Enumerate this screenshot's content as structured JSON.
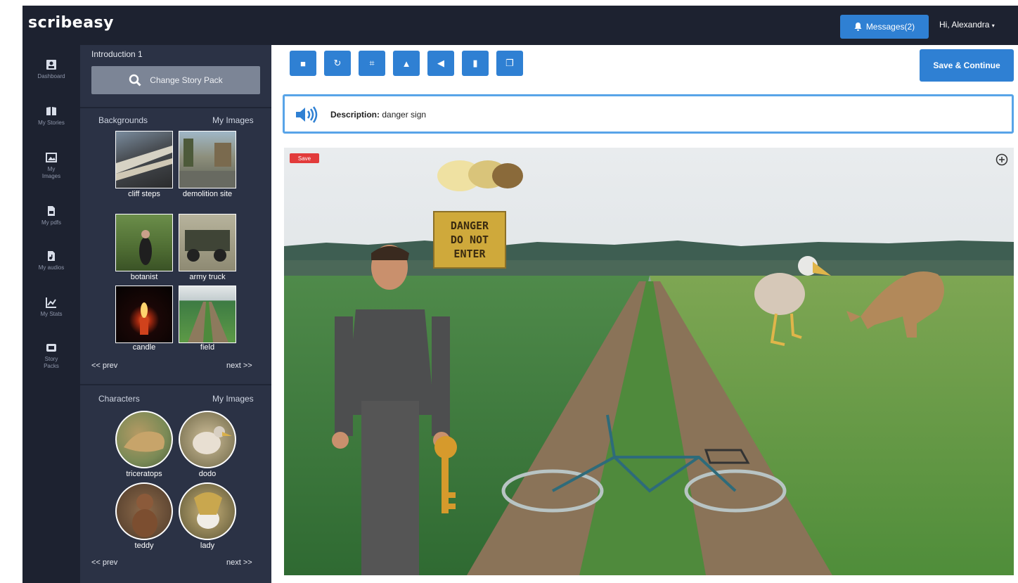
{
  "app": {
    "logo": "scribeasy",
    "messages_label": "Messages(2)",
    "user_label": "Hi, Alexandra"
  },
  "rail": {
    "items": [
      {
        "label": "Dashboard",
        "icon": "dashboard-icon"
      },
      {
        "label": "My Stories",
        "icon": "book-icon"
      },
      {
        "label": "My Images",
        "icon": "image-icon"
      },
      {
        "label": "My pdfs",
        "icon": "pdf-icon"
      },
      {
        "label": "My audios",
        "icon": "audio-icon"
      },
      {
        "label": "My Stats",
        "icon": "stats-icon"
      },
      {
        "label": "Story Packs",
        "icon": "pack-icon"
      }
    ]
  },
  "panel": {
    "title": "Introduction 1",
    "change_pack_label": "Change Story Pack",
    "backgrounds": {
      "label": "Backgrounds",
      "my_images": "My Images",
      "items": [
        "cliff steps",
        "demolition site",
        "botanist",
        "army truck",
        "candle",
        "field"
      ],
      "prev": "<< prev",
      "next": "next >>"
    },
    "characters": {
      "label": "Characters",
      "my_images": "My Images",
      "items": [
        "triceratops",
        "dodo",
        "teddy",
        "lady"
      ],
      "prev": "<< prev",
      "next": "next >>"
    }
  },
  "toolbar": {
    "buttons": [
      "delete-icon",
      "redo-icon",
      "resize-icon",
      "flip-icon",
      "send-back-icon",
      "bring-front-icon",
      "copy-icon"
    ],
    "glyphs": [
      "■",
      "↻",
      "⌗",
      "▲",
      "◀",
      "▮",
      "❐"
    ],
    "save_label": "Save & Continue"
  },
  "description": {
    "prefix": "Description:",
    "text": "danger sign"
  },
  "scene": {
    "save_badge": "Save",
    "sign_lines": [
      "DANGER",
      "DO NOT",
      "ENTER"
    ]
  },
  "colors": {
    "nav": "#1d2230",
    "panel": "#2b3245",
    "accent": "#2f80d3",
    "danger": "#e23b3b"
  }
}
